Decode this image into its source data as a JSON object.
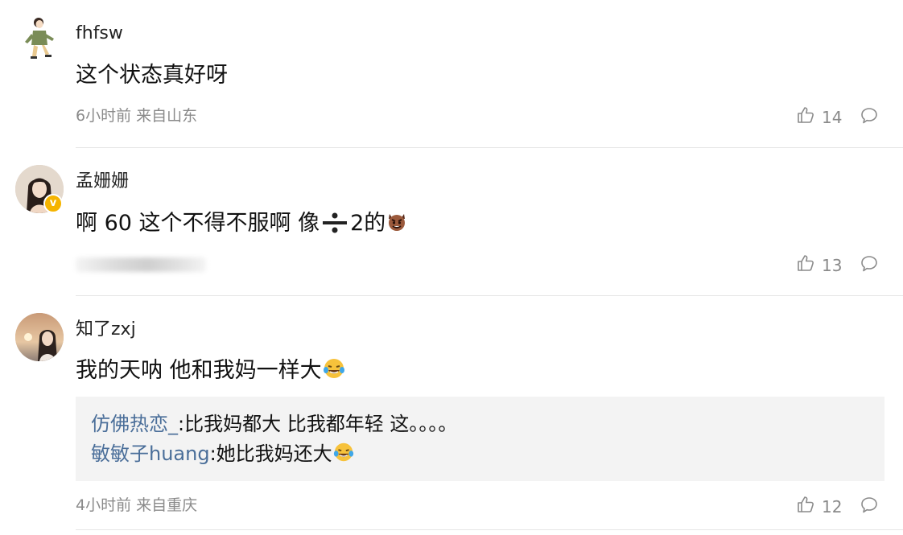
{
  "comments": [
    {
      "username": "fhfsw",
      "content": "这个状态真好呀",
      "meta": "6小时前 来自山东",
      "likes": "14"
    },
    {
      "username": "孟姗姗",
      "content_a": "啊 60 这个不得不服啊 像",
      "content_b": "2的",
      "likes": "13",
      "verified": true
    },
    {
      "username": "知了zxj",
      "content": "我的天呐 他和我妈一样大",
      "meta": "4小时前 来自重庆",
      "likes": "12",
      "replies": [
        {
          "user": "仿佛热恋_",
          "text": ":比我妈都大 比我都年轻 这。。。。"
        },
        {
          "user": "敏敏子huang",
          "text": ":她比我妈还大"
        }
      ]
    }
  ],
  "icons": {
    "like": "thumbs-up-icon",
    "reply": "comment-bubble-icon",
    "divide": "division-sign-icon",
    "laugh": "laughing-tears-emoji",
    "devil": "devil-face-emoji"
  },
  "colors": {
    "reply_user": "#4a6e99",
    "meta": "#8a8a8a",
    "verified_badge": "#f5b400"
  }
}
